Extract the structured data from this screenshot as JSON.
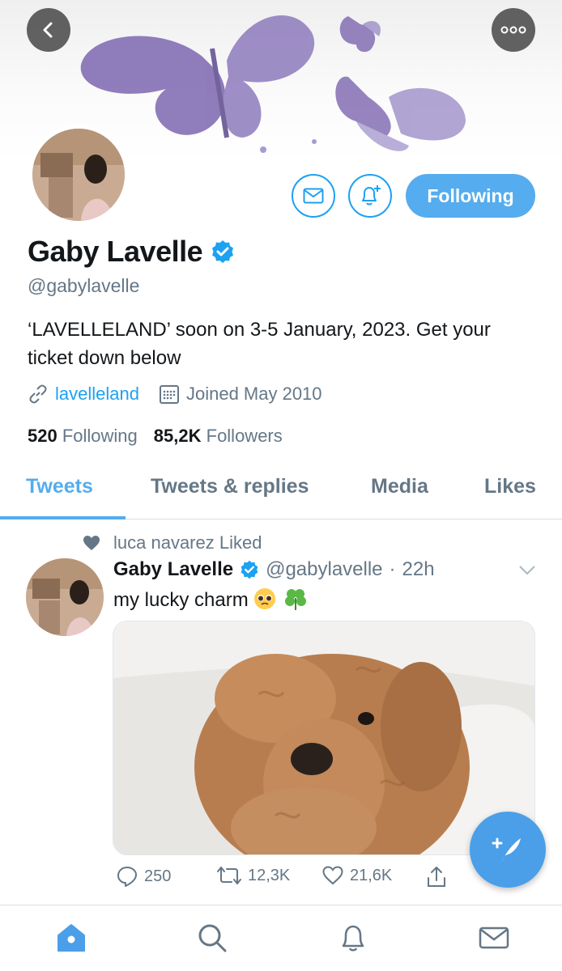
{
  "header": {
    "back_icon": "chevron-left-icon",
    "more_icon": "more-dots-icon"
  },
  "profile": {
    "name": "Gaby Lavelle",
    "handle": "@gabylavelle",
    "bio": "‘LAVELLELAND’ soon on 3-5 January, 2023. Get your ticket down below",
    "link_text": "lavelleland",
    "joined": "Joined May 2010",
    "following_count": "520",
    "following_label": "Following",
    "followers_count": "85,2K",
    "followers_label": "Followers",
    "follow_button_label": "Following",
    "accent_color": "#1da1f2"
  },
  "tabs": [
    {
      "label": "Tweets",
      "active": true
    },
    {
      "label": "Tweets & replies",
      "active": false
    },
    {
      "label": "Media",
      "active": false
    },
    {
      "label": "Likes",
      "active": false
    }
  ],
  "tweet": {
    "social_context": "luca navarez Liked",
    "author_name": "Gaby Lavelle",
    "author_handle": "@gabylavelle",
    "separator": "·",
    "time": "22h",
    "text": "my lucky charm",
    "emojis": [
      "pleading-face",
      "shamrock"
    ],
    "replies": "250",
    "retweets": "12,3K",
    "likes": "21,6K"
  },
  "bottom_nav": [
    "home-icon",
    "search-icon",
    "notifications-icon",
    "messages-icon"
  ]
}
